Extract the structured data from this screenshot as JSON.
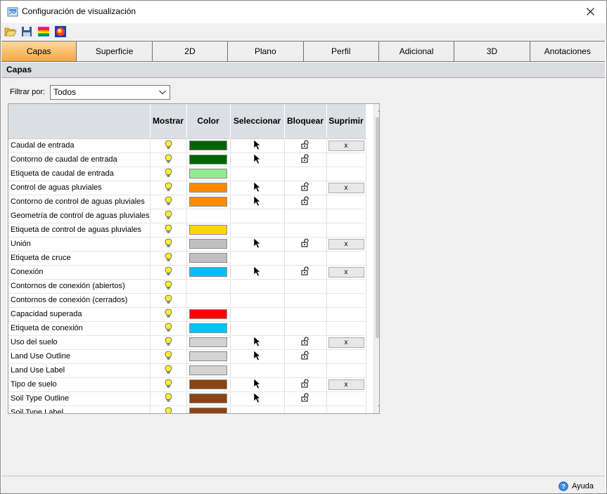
{
  "window": {
    "title": "Configuración de visualización"
  },
  "toolbar": {
    "icons": [
      "folder-open-icon",
      "save-icon",
      "rainbow-palette-icon",
      "color-scheme-icon"
    ]
  },
  "tabs": [
    {
      "label": "Capas",
      "active": true
    },
    {
      "label": "Superficie"
    },
    {
      "label": "2D"
    },
    {
      "label": "Plano"
    },
    {
      "label": "Perfil"
    },
    {
      "label": "Adicional"
    },
    {
      "label": "3D"
    },
    {
      "label": "Anotaciones"
    }
  ],
  "section": {
    "title": "Capas"
  },
  "filter": {
    "label": "Filtrar por:",
    "value": "Todos"
  },
  "grid": {
    "columns": [
      "",
      "Mostrar",
      "Color",
      "Seleccionar",
      "Bloquear",
      "Suprimir"
    ],
    "rows": [
      {
        "name": "Caudal de entrada",
        "color": "#006400",
        "select": true,
        "lock": true,
        "del": "x"
      },
      {
        "name": "Contorno de caudal de entrada",
        "color": "#006400",
        "select": true,
        "lock": true,
        "del": ""
      },
      {
        "name": "Etiqueta de caudal de entrada",
        "color": "#90ee90",
        "select": false,
        "lock": false,
        "del": ""
      },
      {
        "name": "Control de aguas pluviales",
        "color": "#ff8c00",
        "select": true,
        "lock": true,
        "del": "x"
      },
      {
        "name": "Contorno de control de aguas pluviales",
        "color": "#ff8c00",
        "select": true,
        "lock": true,
        "del": ""
      },
      {
        "name": "Geometría de control de aguas pluviales",
        "color": "",
        "select": false,
        "lock": false,
        "del": ""
      },
      {
        "name": "Etiqueta de control de aguas pluviales",
        "color": "#ffd700",
        "select": false,
        "lock": false,
        "del": ""
      },
      {
        "name": "Unión",
        "color": "#c0c0c0",
        "select": true,
        "lock": true,
        "del": "x"
      },
      {
        "name": "Etiqueta de cruce",
        "color": "#c0c0c0",
        "select": false,
        "lock": false,
        "del": ""
      },
      {
        "name": "Conexión",
        "color": "#00bfff",
        "select": true,
        "lock": true,
        "del": "x"
      },
      {
        "name": "Contornos de conexión (abiertos)",
        "color": "",
        "select": false,
        "lock": false,
        "del": ""
      },
      {
        "name": "Contornos de conexión (cerrados)",
        "color": "",
        "select": false,
        "lock": false,
        "del": ""
      },
      {
        "name": "Capacidad superada",
        "color": "#ff0000",
        "select": false,
        "lock": false,
        "del": ""
      },
      {
        "name": "Etiqueta de conexión",
        "color": "#00bfff",
        "select": false,
        "lock": false,
        "del": ""
      },
      {
        "name": "Uso del suelo",
        "color": "#d3d3d3",
        "select": true,
        "lock": true,
        "del": "x"
      },
      {
        "name": "Land Use Outline",
        "color": "#d3d3d3",
        "select": true,
        "lock": true,
        "del": ""
      },
      {
        "name": "Land Use Label",
        "color": "#d3d3d3",
        "select": false,
        "lock": false,
        "del": ""
      },
      {
        "name": "Tipo de suelo",
        "color": "#8b4513",
        "select": true,
        "lock": true,
        "del": "x"
      },
      {
        "name": "Soil Type Outline",
        "color": "#8b4513",
        "select": true,
        "lock": true,
        "del": ""
      },
      {
        "name": "Soil Type Label",
        "color": "#8b4513",
        "select": false,
        "lock": false,
        "del": ""
      }
    ]
  },
  "footer": {
    "help_label": "Ayuda"
  }
}
